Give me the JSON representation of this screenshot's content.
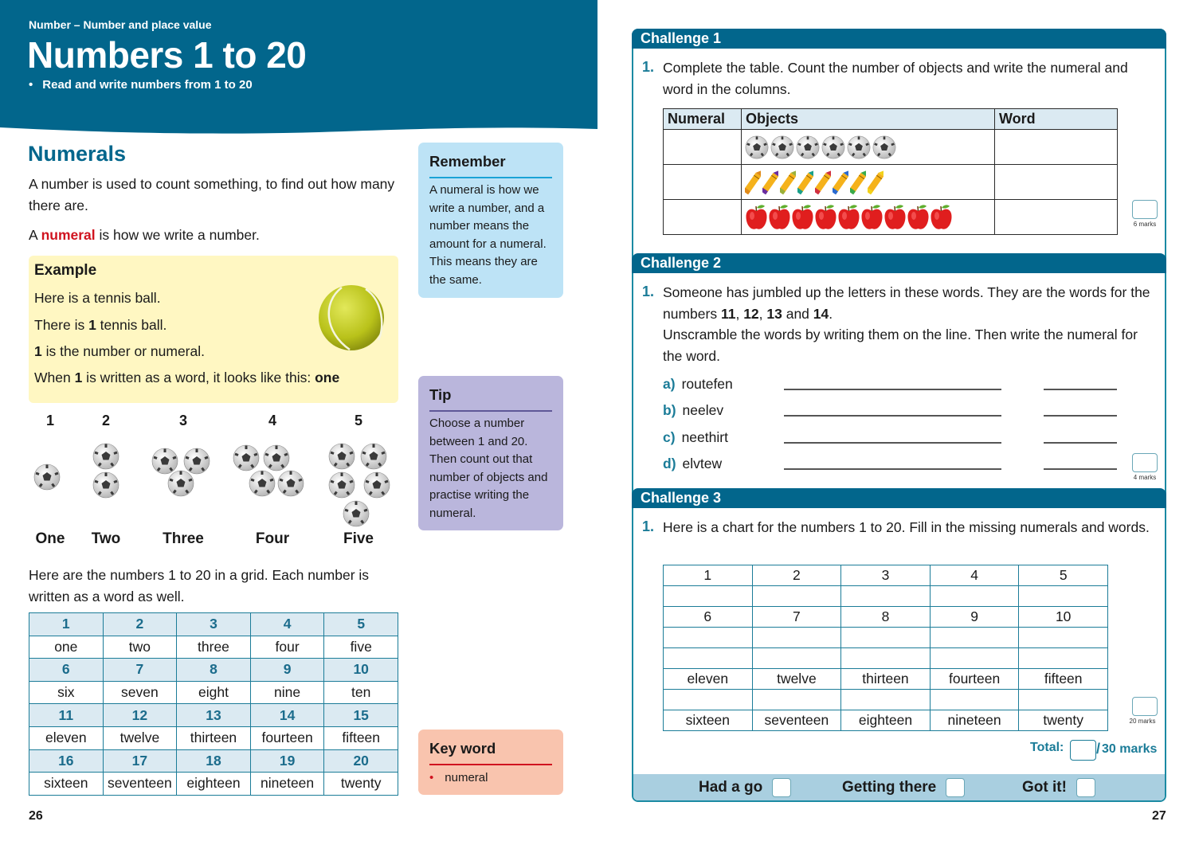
{
  "left_page": {
    "header": {
      "subtitle": "Number – Number and place value",
      "title": "Numbers 1 to 20",
      "bullet": "Read and write numbers from 1 to 20",
      "bullet_symbol": "•"
    },
    "section_heading": "Numerals",
    "intro": {
      "p1": "A number is used to count something, to find out how many there are.",
      "p2_before": "A ",
      "p2_highlight": "numeral",
      "p2_after": " is how we write a number."
    },
    "example": {
      "title": "Example",
      "line1": "Here is a tennis ball.",
      "line2_before": "There is ",
      "line2_bold": "1",
      "line2_after": " tennis ball.",
      "line3_bold": "1",
      "line3_after": " is the number or numeral.",
      "line4_before": "When ",
      "line4_bold": "1",
      "line4_mid": " is written as a word, it looks like this: ",
      "line4_word": "one",
      "image": "tennis-ball"
    },
    "counting": [
      {
        "numeral": "1",
        "word": "One",
        "count": 1
      },
      {
        "numeral": "2",
        "word": "Two",
        "count": 2
      },
      {
        "numeral": "3",
        "word": "Three",
        "count": 3
      },
      {
        "numeral": "4",
        "word": "Four",
        "count": 4
      },
      {
        "numeral": "5",
        "word": "Five",
        "count": 5
      }
    ],
    "grid_intro": "Here are the numbers 1 to 20 in a grid. Each number is written as a word as well.",
    "number_grid": [
      {
        "numerals": [
          "1",
          "2",
          "3",
          "4",
          "5"
        ],
        "words": [
          "one",
          "two",
          "three",
          "four",
          "five"
        ]
      },
      {
        "numerals": [
          "6",
          "7",
          "8",
          "9",
          "10"
        ],
        "words": [
          "six",
          "seven",
          "eight",
          "nine",
          "ten"
        ]
      },
      {
        "numerals": [
          "11",
          "12",
          "13",
          "14",
          "15"
        ],
        "words": [
          "eleven",
          "twelve",
          "thirteen",
          "fourteen",
          "fifteen"
        ]
      },
      {
        "numerals": [
          "16",
          "17",
          "18",
          "19",
          "20"
        ],
        "words": [
          "sixteen",
          "seventeen",
          "eighteen",
          "nineteen",
          "twenty"
        ]
      }
    ],
    "remember": {
      "title": "Remember",
      "text": "A numeral is how we write a number, and a number means the amount for a numeral. This means they are the same."
    },
    "tip": {
      "title": "Tip",
      "text": "Choose a number between 1 and 20. Then count out that number of objects and practise writing the numeral."
    },
    "key_word": {
      "title": "Key word",
      "items": [
        "numeral"
      ],
      "bullet_symbol": "•"
    },
    "page_number": "26"
  },
  "right_page": {
    "challenge1": {
      "title": "Challenge 1",
      "q_num": "1.",
      "question": "Complete the table. Count the number of objects and write the numeral and word in the columns.",
      "headers": [
        "Numeral",
        "Objects",
        "Word"
      ],
      "rows": [
        {
          "object": "football",
          "count": 6,
          "numeral": "",
          "word": ""
        },
        {
          "object": "crayon",
          "count": 8,
          "numeral": "",
          "word": ""
        },
        {
          "object": "apple",
          "count": 9,
          "numeral": "",
          "word": ""
        }
      ],
      "marks": "6 marks"
    },
    "challenge2": {
      "title": "Challenge 2",
      "q_num": "1.",
      "question_before": "Someone has jumbled up the letters in these words. They are the words for the numbers ",
      "numbers": [
        "11",
        "12",
        "13",
        "14"
      ],
      "question_after": "Unscramble the words by writing them on the line. Then write the numeral for the word.",
      "items": [
        {
          "letter": "a)",
          "jumbled": "routefen"
        },
        {
          "letter": "b)",
          "jumbled": "neelev"
        },
        {
          "letter": "c)",
          "jumbled": "neethirt"
        },
        {
          "letter": "d)",
          "jumbled": "elvtew"
        }
      ],
      "marks": "4 marks"
    },
    "challenge3": {
      "title": "Challenge 3",
      "q_num": "1.",
      "question": "Here is a chart for the numbers 1 to 20. Fill in the missing numerals and words.",
      "rows": [
        [
          "1",
          "2",
          "3",
          "4",
          "5"
        ],
        [
          "",
          "",
          "",
          "",
          ""
        ],
        [
          "6",
          "7",
          "8",
          "9",
          "10"
        ],
        [
          "",
          "",
          "",
          "",
          ""
        ],
        [
          "",
          "",
          "",
          "",
          ""
        ],
        [
          "eleven",
          "twelve",
          "thirteen",
          "fourteen",
          "fifteen"
        ],
        [
          "",
          "",
          "",
          "",
          ""
        ],
        [
          "sixteen",
          "seventeen",
          "eighteen",
          "nineteen",
          "twenty"
        ]
      ],
      "marks": "20 marks"
    },
    "total": {
      "label": "Total:",
      "value": "",
      "out_of": "30 marks"
    },
    "self_assessment": [
      {
        "label": "Had a go",
        "checked": false
      },
      {
        "label": "Getting there",
        "checked": false
      },
      {
        "label": "Got it!",
        "checked": false
      }
    ],
    "page_number": "27"
  },
  "colors": {
    "brand_blue": "#02668c",
    "teal_text": "#1b7c98",
    "highlight_red": "#d0131f",
    "example_bg": "#fff7c2",
    "remember_bg": "#bde3f6",
    "tip_bg": "#bab6dc",
    "keyword_bg": "#f9c4ae",
    "progress_bg": "#a9cfe0"
  }
}
